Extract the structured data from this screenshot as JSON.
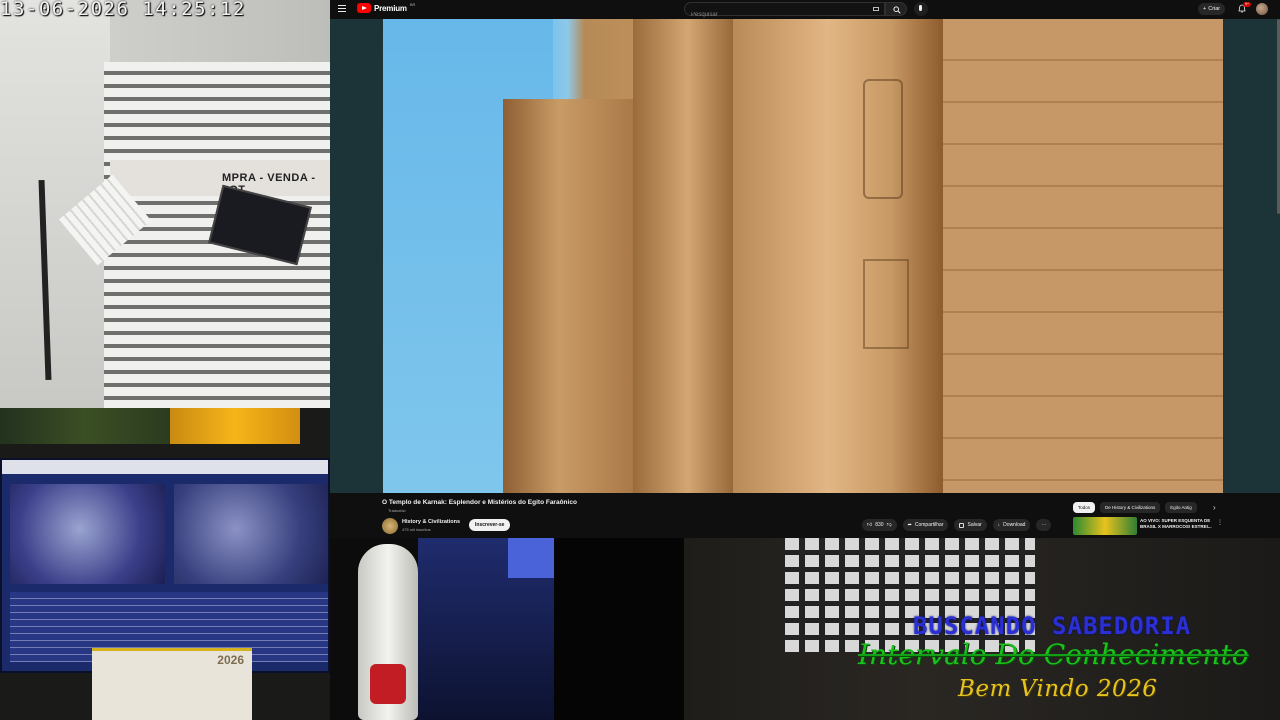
{
  "camera": {
    "timestamp": "13-06-2026 14:25:12",
    "sign_top": "MPRA - VENDA - LOT"
  },
  "desk": {
    "calendar_year": "2026"
  },
  "youtube": {
    "logo_text": "Premium",
    "logo_sup": "BR",
    "search_placeholder": "Pesquisar",
    "create_label": "Criar",
    "notifications_count": "9+",
    "video": {
      "title": "O Templo de Karnak: Esplendor e Mistérios do Egito Faraônico",
      "tag": "Traduzido",
      "channel_name": "History & Civilizations",
      "channel_subs": "475 mil inscritos",
      "subscribe_label": "Inscrever-se",
      "likes": "830",
      "share_label": "Compartilhar",
      "save_label": "Salvar",
      "download_label": "Download"
    },
    "chips": [
      "Todos",
      "De History & Civilizations",
      "Egito Antig"
    ],
    "recommended": {
      "title": "AO VIVO: SUPER ESQUENTA DE BRASIL X MARROCOS! ESTREI..."
    }
  },
  "overlay": {
    "line1": "BUSCANDO SABEDORIA",
    "line2": "Intervalo Do Conhecimento",
    "line3": "Bem Vindo 2026"
  },
  "colors": {
    "yt_red": "#ff0000",
    "overlay_blue": "#2a2fd6",
    "overlay_green": "#18c21b",
    "overlay_yellow": "#e6c41d"
  }
}
